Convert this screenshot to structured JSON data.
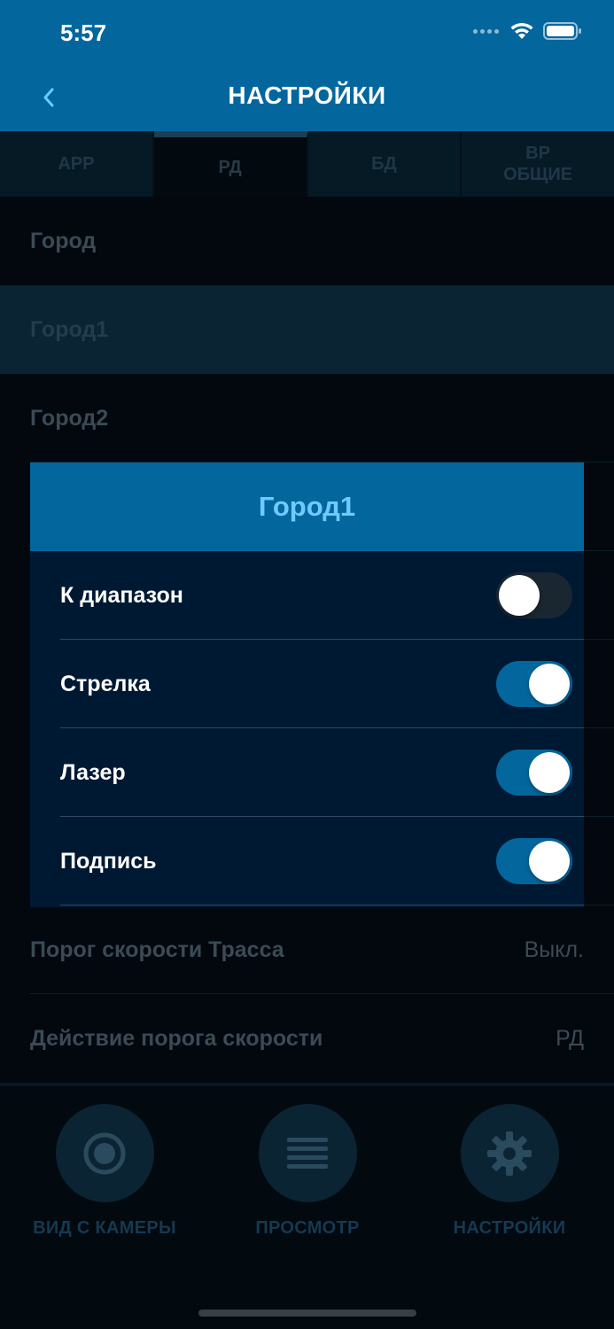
{
  "status_bar": {
    "time": "5:57"
  },
  "header": {
    "title": "НАСТРОЙКИ"
  },
  "tabs": [
    {
      "label": "APP",
      "active": false
    },
    {
      "label": "РД",
      "active": true
    },
    {
      "label": "БД",
      "active": false
    },
    {
      "label": "ВР\nОБЩИЕ",
      "active": false
    }
  ],
  "list": {
    "items": [
      {
        "label": "Город",
        "value": ""
      },
      {
        "label": "Город1",
        "value": ""
      },
      {
        "label": "Город2",
        "value": ""
      },
      {
        "label": "Порог скорости Трасса",
        "value": "Выкл."
      },
      {
        "label": "Действие порога скорости",
        "value": "РД"
      }
    ]
  },
  "dialog": {
    "title": "Город1",
    "options": [
      {
        "label": "К диапазон",
        "enabled": false
      },
      {
        "label": "Стрелка",
        "enabled": true
      },
      {
        "label": "Лазер",
        "enabled": true
      },
      {
        "label": "Подпись",
        "enabled": true
      }
    ]
  },
  "bottom_nav": [
    {
      "label": "ВИД С КАМЕРЫ",
      "icon": "camera-record-icon"
    },
    {
      "label": "ПРОСМОТР",
      "icon": "list-icon"
    },
    {
      "label": "НАСТРОЙКИ",
      "icon": "gear-icon"
    }
  ],
  "colors": {
    "accent": "#03679e",
    "dialog_bg": "#001933",
    "dialog_title": "#6fcbff",
    "toggle_off": "#1a2731"
  }
}
